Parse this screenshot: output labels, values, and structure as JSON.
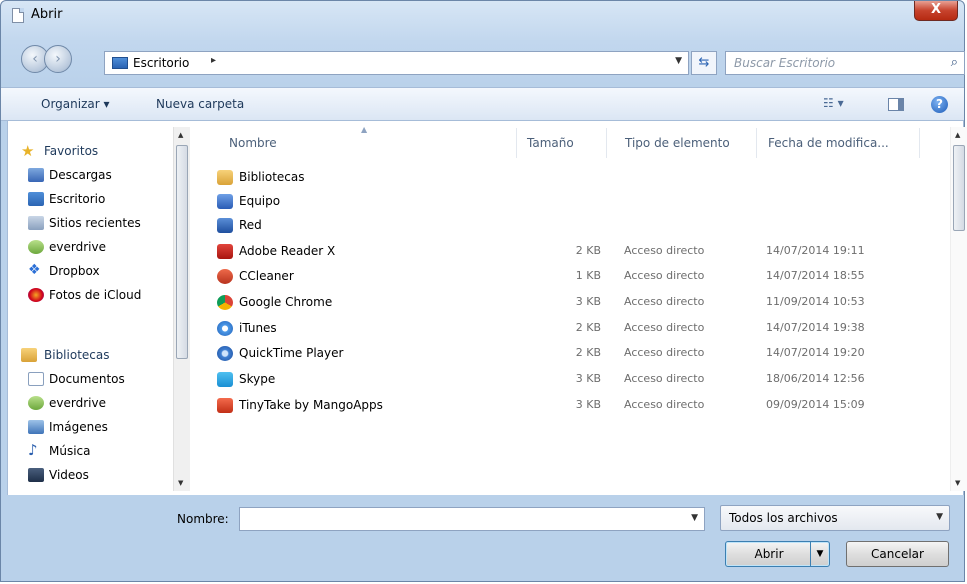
{
  "window": {
    "title": "Abrir",
    "close_symbol": "X"
  },
  "address": {
    "location": "Escritorio",
    "separator": "▸"
  },
  "search": {
    "placeholder": "Buscar Escritorio"
  },
  "toolbar": {
    "organize_label": "Organizar ▾",
    "new_folder_label": "Nueva carpeta"
  },
  "sidebar": {
    "favorites_header": "Favoritos",
    "favorites": [
      {
        "label": "Descargas",
        "icon": "download-folder-icon"
      },
      {
        "label": "Escritorio",
        "icon": "desktop-folder-icon"
      },
      {
        "label": "Sitios recientes",
        "icon": "recent-places-icon"
      },
      {
        "label": "everdrive",
        "icon": "everdrive-icon"
      },
      {
        "label": "Dropbox",
        "icon": "dropbox-icon"
      },
      {
        "label": "Fotos de iCloud",
        "icon": "icloud-photos-icon"
      }
    ],
    "libraries_header": "Bibliotecas",
    "libraries": [
      {
        "label": "Documentos",
        "icon": "documents-icon"
      },
      {
        "label": "everdrive",
        "icon": "everdrive-icon"
      },
      {
        "label": "Imágenes",
        "icon": "pictures-icon"
      },
      {
        "label": "Música",
        "icon": "music-icon"
      },
      {
        "label": "Videos",
        "icon": "videos-icon"
      }
    ]
  },
  "columns": {
    "name": "Nombre",
    "size": "Tamaño",
    "type": "Tipo de elemento",
    "date": "Fecha de modifica..."
  },
  "files": [
    {
      "name": "Bibliotecas",
      "size": "",
      "type": "",
      "date": "",
      "icon": "libraries-icon",
      "color": "#e9b84a"
    },
    {
      "name": "Equipo",
      "size": "",
      "type": "",
      "date": "",
      "icon": "computer-icon",
      "color": "#3b6fc4"
    },
    {
      "name": "Red",
      "size": "",
      "type": "",
      "date": "",
      "icon": "network-icon",
      "color": "#2f62b8"
    },
    {
      "name": "Adobe Reader X",
      "size": "2 KB",
      "type": "Acceso directo",
      "date": "14/07/2014 19:11",
      "icon": "adobe-reader-icon",
      "color": "#c8231b"
    },
    {
      "name": "CCleaner",
      "size": "1 KB",
      "type": "Acceso directo",
      "date": "14/07/2014 18:55",
      "icon": "ccleaner-icon",
      "color": "#d2432a"
    },
    {
      "name": "Google Chrome",
      "size": "3 KB",
      "type": "Acceso directo",
      "date": "11/09/2014 10:53",
      "icon": "chrome-icon",
      "color": "#e8b32a"
    },
    {
      "name": "iTunes",
      "size": "2 KB",
      "type": "Acceso directo",
      "date": "14/07/2014 19:38",
      "icon": "itunes-icon",
      "color": "#3f8ad8"
    },
    {
      "name": "QuickTime Player",
      "size": "2 KB",
      "type": "Acceso directo",
      "date": "14/07/2014 19:20",
      "icon": "quicktime-icon",
      "color": "#3f7fd2"
    },
    {
      "name": "Skype",
      "size": "3 KB",
      "type": "Acceso directo",
      "date": "18/06/2014 12:56",
      "icon": "skype-icon",
      "color": "#2aa5e6"
    },
    {
      "name": "TinyTake by MangoApps",
      "size": "3 KB",
      "type": "Acceso directo",
      "date": "09/09/2014 15:09",
      "icon": "tinytake-icon",
      "color": "#e24a2e"
    }
  ],
  "bottom": {
    "name_label": "Nombre:",
    "name_value": "",
    "filter_value": "Todos los archivos",
    "open_label": "Abrir",
    "cancel_label": "Cancelar"
  },
  "colors": {
    "accent": "#3c7fb1",
    "frame": "#b9d1ea",
    "close": "#c7432d"
  }
}
